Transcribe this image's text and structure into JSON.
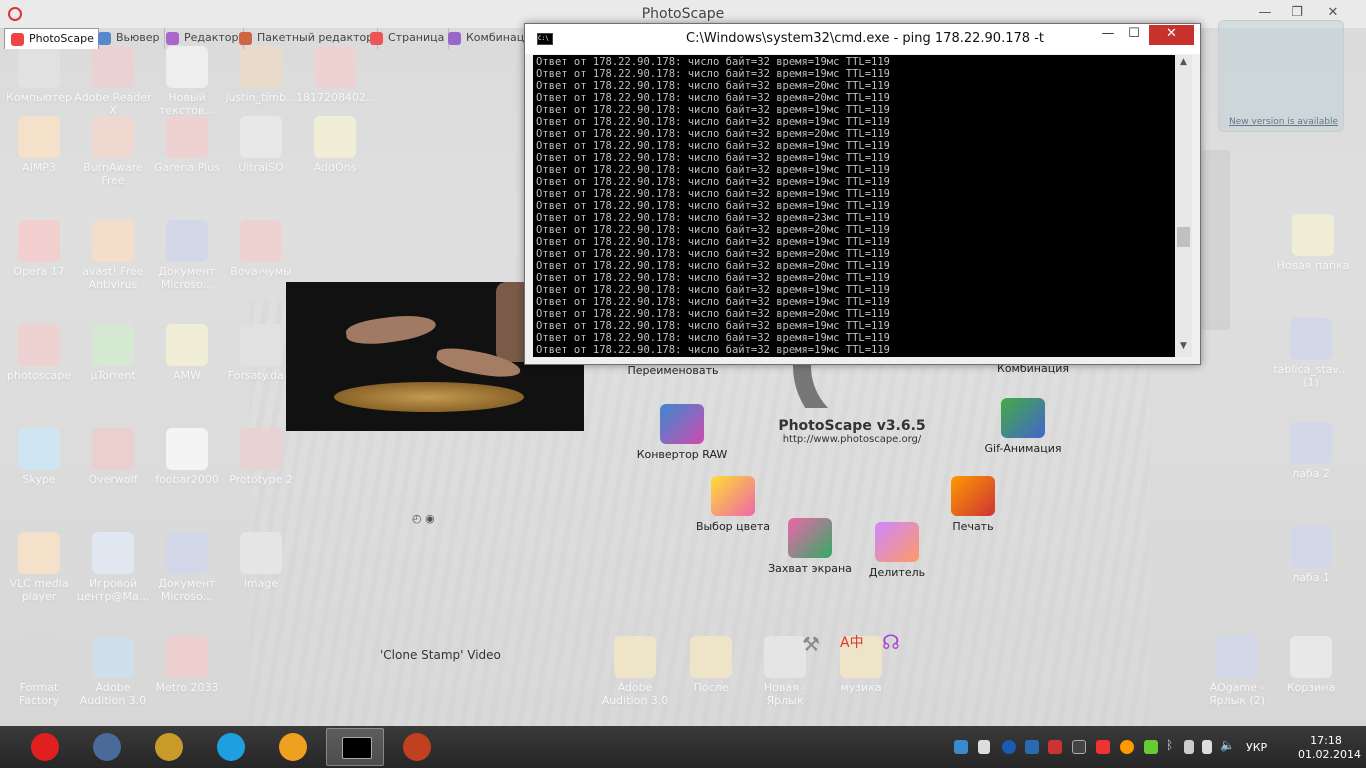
{
  "photoscape": {
    "title": "PhotoScape",
    "tabs": [
      {
        "label": "PhotoScape"
      },
      {
        "label": "Вьювер"
      },
      {
        "label": "Редактор"
      },
      {
        "label": "Пакетный редактор"
      },
      {
        "label": "Страница"
      },
      {
        "label": "Комбинаци"
      }
    ],
    "launcher": {
      "rename": "Переименовать",
      "combine": "Комбинация",
      "raw": "Конвертор RAW",
      "gif": "Gif-Анимация",
      "color": "Выбор цвета",
      "print": "Печать",
      "capture": "Захват экрана",
      "splitter": "Делитель"
    },
    "brand_name": "PhotoScape v3.6.5",
    "brand_url": "http://www.photoscape.org/",
    "caption": "'Clone Stamp' Video"
  },
  "desktop": {
    "icons": [
      {
        "label": "Компьютер"
      },
      {
        "label": "Adobe Reader X"
      },
      {
        "label": "Новый текстов..."
      },
      {
        "label": "justin_timb..."
      },
      {
        "label": "1817208402..."
      },
      {
        "label": "AIMP3"
      },
      {
        "label": "BurnAware Free"
      },
      {
        "label": "Garena Plus"
      },
      {
        "label": "UltraISO"
      },
      {
        "label": "AddOns"
      },
      {
        "label": "Opera 17"
      },
      {
        "label": "avast! Free Antivirus"
      },
      {
        "label": "Документ Microso..."
      },
      {
        "label": "Bova-чумы"
      },
      {
        "label": "photoscape"
      },
      {
        "label": "µTorrent"
      },
      {
        "label": "AMW"
      },
      {
        "label": "Forsaty.da..."
      },
      {
        "label": "Skype"
      },
      {
        "label": "Overwolf"
      },
      {
        "label": "foobar2000"
      },
      {
        "label": "Prototype 2"
      },
      {
        "label": "VLC media player"
      },
      {
        "label": "Игровой центр@Ma..."
      },
      {
        "label": "Документ Microso..."
      },
      {
        "label": "image"
      },
      {
        "label": "Format Factory"
      },
      {
        "label": "Adobe Audition 3.0"
      },
      {
        "label": "Metro 2033"
      },
      {
        "label": "Adobe Audition 3.0"
      },
      {
        "label": "После"
      },
      {
        "label": "Новая - Ярлык"
      },
      {
        "label": "музика"
      },
      {
        "label": "Новая папка"
      },
      {
        "label": "tablica_stav... (1)"
      },
      {
        "label": "лаба 2"
      },
      {
        "label": "лаба 1"
      },
      {
        "label": "AOgame - Ярлык (2)"
      },
      {
        "label": "Корзина"
      }
    ],
    "gadget_link": "New version is available"
  },
  "cmd": {
    "title": "C:\\Windows\\system32\\cmd.exe - ping  178.22.90.178 -t",
    "lines": [
      "Ответ от 178.22.90.178: число байт=32 время=19мс TTL=119",
      "Ответ от 178.22.90.178: число байт=32 время=19мс TTL=119",
      "Ответ от 178.22.90.178: число байт=32 время=20мс TTL=119",
      "Ответ от 178.22.90.178: число байт=32 время=20мс TTL=119",
      "Ответ от 178.22.90.178: число байт=32 время=19мс TTL=119",
      "Ответ от 178.22.90.178: число байт=32 время=19мс TTL=119",
      "Ответ от 178.22.90.178: число байт=32 время=20мс TTL=119",
      "Ответ от 178.22.90.178: число байт=32 время=19мс TTL=119",
      "Ответ от 178.22.90.178: число байт=32 время=19мс TTL=119",
      "Ответ от 178.22.90.178: число байт=32 время=19мс TTL=119",
      "Ответ от 178.22.90.178: число байт=32 время=19мс TTL=119",
      "Ответ от 178.22.90.178: число байт=32 время=19мс TTL=119",
      "Ответ от 178.22.90.178: число байт=32 время=19мс TTL=119",
      "Ответ от 178.22.90.178: число байт=32 время=23мс TTL=119",
      "Ответ от 178.22.90.178: число байт=32 время=20мс TTL=119",
      "Ответ от 178.22.90.178: число байт=32 время=19мс TTL=119",
      "Ответ от 178.22.90.178: число байт=32 время=20мс TTL=119",
      "Ответ от 178.22.90.178: число байт=32 время=20мс TTL=119",
      "Ответ от 178.22.90.178: число байт=32 время=20мс TTL=119",
      "Ответ от 178.22.90.178: число байт=32 время=19мс TTL=119",
      "Ответ от 178.22.90.178: число байт=32 время=19мс TTL=119",
      "Ответ от 178.22.90.178: число байт=32 время=20мс TTL=119",
      "Ответ от 178.22.90.178: число байт=32 время=19мс TTL=119",
      "Ответ от 178.22.90.178: число байт=32 время=19мс TTL=119",
      "Ответ от 178.22.90.178: число байт=32 время=19мс TTL=119"
    ],
    "min_glyph": "—",
    "max_glyph": "☐",
    "close_glyph": "✕"
  },
  "taskbar": {
    "apps": [
      {
        "name": "opera",
        "color": "#e0201e"
      },
      {
        "name": "teamspeak",
        "color": "#4a6a9a"
      },
      {
        "name": "world-of-warcraft",
        "color": "#c89a2a"
      },
      {
        "name": "skype",
        "color": "#1ea0e0"
      },
      {
        "name": "aimp",
        "color": "#f0a020"
      },
      {
        "name": "cmd",
        "color": "#000000"
      },
      {
        "name": "photoscape",
        "color": "#c04020"
      }
    ],
    "language": "УКР",
    "time": "17:18",
    "date": "01.02.2014"
  }
}
